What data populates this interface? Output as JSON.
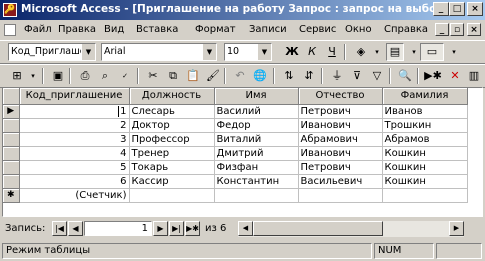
{
  "window": {
    "title": "Microsoft Access - [Приглашение на работу Запрос : запрос на выборку]",
    "app_icon": "key-icon",
    "btn_minimize": "_",
    "btn_maximize": "□",
    "btn_close": "×",
    "doc_btn_minimize": "_",
    "doc_btn_restore": "▫",
    "doc_btn_close": "×"
  },
  "menu": {
    "items": [
      "Файл",
      "Правка",
      "Вид",
      "Вставка",
      "Формат",
      "Записи",
      "Сервис",
      "Окно",
      "Справка"
    ],
    "underlined_keys": [
      "Ф",
      "П",
      "В",
      "В",
      "м",
      "З",
      "С",
      "О",
      "С"
    ]
  },
  "format_toolbar": {
    "field_combo": "Код_Приглаше",
    "font_combo": "Arial",
    "size_combo": "10",
    "bold": "Ж",
    "italic": "К",
    "underline": "Ч"
  },
  "datasheet": {
    "columns": [
      "Код_приглашение",
      "Должность",
      "Имя",
      "Отчество",
      "Фамилия"
    ],
    "rows": [
      {
        "selector": "▶",
        "id": "1",
        "position": "Слесарь",
        "first": "Василий",
        "middle": "Петрович",
        "last": "Иванов"
      },
      {
        "selector": "",
        "id": "2",
        "position": "Доктор",
        "first": "Федор",
        "middle": "Иванович",
        "last": "Трошкин"
      },
      {
        "selector": "",
        "id": "3",
        "position": "Профессор",
        "first": "Виталий",
        "middle": "Абрамович",
        "last": "Абрамов"
      },
      {
        "selector": "",
        "id": "4",
        "position": "Тренер",
        "first": "Дмитрий",
        "middle": "Иванович",
        "last": "Кошкин"
      },
      {
        "selector": "",
        "id": "5",
        "position": "Токарь",
        "first": "Физфан",
        "middle": "Петрович",
        "last": "Кошкин"
      },
      {
        "selector": "",
        "id": "6",
        "position": "Кассир",
        "first": "Константин",
        "middle": "Васильевич",
        "last": "Кошкин"
      }
    ],
    "new_row": {
      "selector": "✱",
      "id": "(Счетчик)"
    }
  },
  "navigation": {
    "label": "Запись:",
    "first": "|◀",
    "prev": "◀",
    "current": "1",
    "next": "▶",
    "last": "▶|",
    "new": "▶✱",
    "of_text": "из 6"
  },
  "status": {
    "mode": "Режим таблицы",
    "num": "NUM"
  },
  "colors": {
    "title_gradient_start": "#0a246a",
    "title_gradient_end": "#a6caf0",
    "chrome": "#d4d0c8"
  }
}
